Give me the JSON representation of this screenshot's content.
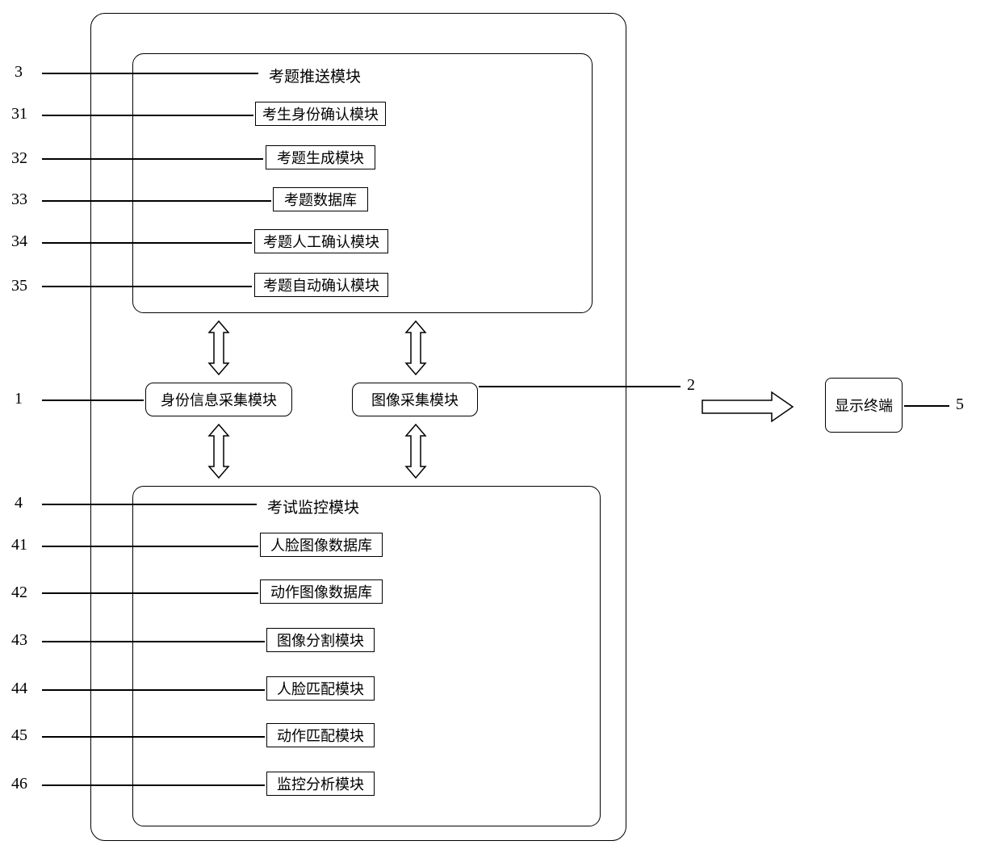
{
  "labels": {
    "n3": "3",
    "n31": "31",
    "n32": "32",
    "n33": "33",
    "n34": "34",
    "n35": "35",
    "n1": "1",
    "n4": "4",
    "n41": "41",
    "n42": "42",
    "n43": "43",
    "n44": "44",
    "n45": "45",
    "n46": "46",
    "n2": "2",
    "n5": "5"
  },
  "top_frame_title": "考题推送模块",
  "top_modules": {
    "m1": "考生身份确认模块",
    "m2": "考题生成模块",
    "m3": "考题数据库",
    "m4": "考题人工确认模块",
    "m5": "考题自动确认模块"
  },
  "mid_left": "身份信息采集模块",
  "mid_right": "图像采集模块",
  "bottom_frame_title": "考试监控模块",
  "bottom_modules": {
    "m1": "人脸图像数据库",
    "m2": "动作图像数据库",
    "m3": "图像分割模块",
    "m4": "人脸匹配模块",
    "m5": "动作匹配模块",
    "m6": "监控分析模块"
  },
  "terminal": "显示终端"
}
